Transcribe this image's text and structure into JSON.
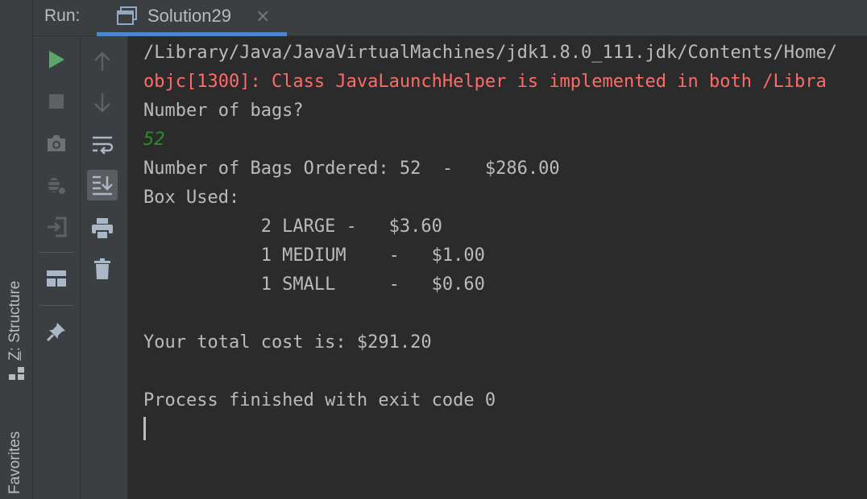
{
  "header": {
    "run_label": "Run:",
    "tab_title": "Solution29",
    "close_glyph": "×"
  },
  "side_tabs": {
    "structure_prefix": "Z",
    "structure_rest": ": Structure",
    "favorites": "Favorites"
  },
  "toolbar_left": [
    "run-icon",
    "stop-icon",
    "camera-icon",
    "debug-settings-icon",
    "restore-layout-icon",
    "layout-icon",
    "pin-icon"
  ],
  "toolbar_right": [
    "up-arrow-icon",
    "down-arrow-icon",
    "soft-wrap-icon",
    "scroll-to-end-icon",
    "print-icon",
    "trash-icon"
  ],
  "colors": {
    "accent": "#4a88c7",
    "run_green": "#59a869",
    "error": "#ff6b68",
    "input": "#2c8c2c",
    "text": "#bbbbbb"
  },
  "console": {
    "lines": [
      {
        "type": "path",
        "text": "/Library/Java/JavaVirtualMachines/jdk1.8.0_111.jdk/Contents/Home/"
      },
      {
        "type": "err",
        "text": "objc[1300]: Class JavaLaunchHelper is implemented in both /Libra"
      },
      {
        "type": "out",
        "text": "Number of bags?"
      },
      {
        "type": "input",
        "text": "52"
      },
      {
        "type": "out",
        "text": "Number of Bags Ordered: 52  -   $286.00"
      },
      {
        "type": "out",
        "text": "Box Used:"
      },
      {
        "type": "out",
        "text": "           2 LARGE -   $3.60"
      },
      {
        "type": "out",
        "text": "           1 MEDIUM    -   $1.00"
      },
      {
        "type": "out",
        "text": "           1 SMALL     -   $0.60"
      },
      {
        "type": "out",
        "text": ""
      },
      {
        "type": "out",
        "text": "Your total cost is: $291.20"
      },
      {
        "type": "out",
        "text": ""
      },
      {
        "type": "out",
        "text": "Process finished with exit code 0"
      }
    ]
  }
}
